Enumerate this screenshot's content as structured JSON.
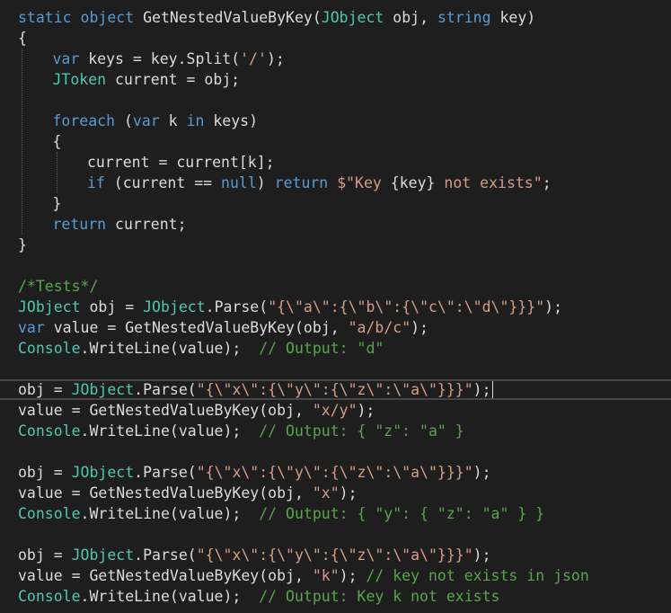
{
  "editor": {
    "theme": {
      "background": "#1e1e1e",
      "keyword": "#569cd6",
      "type": "#4ec9b0",
      "string": "#d69d85",
      "comment": "#57a64a",
      "text": "#dcdcdc"
    },
    "lines": [
      {
        "indent": 0,
        "tokens": [
          [
            "kw",
            "static"
          ],
          [
            "pl",
            " "
          ],
          [
            "kw",
            "object"
          ],
          [
            "pl",
            " GetNestedValueByKey("
          ],
          [
            "ty",
            "JObject"
          ],
          [
            "pl",
            " obj, "
          ],
          [
            "kw",
            "string"
          ],
          [
            "pl",
            " key)"
          ]
        ]
      },
      {
        "indent": 0,
        "tokens": [
          [
            "pl",
            "{"
          ]
        ]
      },
      {
        "indent": 1,
        "tokens": [
          [
            "kw",
            "var"
          ],
          [
            "pl",
            " keys = key.Split("
          ],
          [
            "st",
            "'/'"
          ],
          [
            "pl",
            ");"
          ]
        ]
      },
      {
        "indent": 1,
        "tokens": [
          [
            "ty",
            "JToken"
          ],
          [
            "pl",
            " current = obj;"
          ]
        ]
      },
      {
        "indent": 0,
        "tokens": []
      },
      {
        "indent": 1,
        "tokens": [
          [
            "kw",
            "foreach"
          ],
          [
            "pl",
            " ("
          ],
          [
            "kw",
            "var"
          ],
          [
            "pl",
            " k "
          ],
          [
            "kw",
            "in"
          ],
          [
            "pl",
            " keys)"
          ]
        ]
      },
      {
        "indent": 1,
        "tokens": [
          [
            "pl",
            "{"
          ]
        ]
      },
      {
        "indent": 2,
        "tokens": [
          [
            "pl",
            "current = current[k];"
          ]
        ]
      },
      {
        "indent": 2,
        "tokens": [
          [
            "kw",
            "if"
          ],
          [
            "pl",
            " (current == "
          ],
          [
            "kw",
            "null"
          ],
          [
            "pl",
            ") "
          ],
          [
            "kw",
            "return"
          ],
          [
            "pl",
            " "
          ],
          [
            "st",
            "$\"Key "
          ],
          [
            "pl",
            "{key}"
          ],
          [
            "st",
            " not exists\""
          ],
          [
            "pl",
            ";"
          ]
        ]
      },
      {
        "indent": 1,
        "tokens": [
          [
            "pl",
            "}"
          ]
        ]
      },
      {
        "indent": 1,
        "tokens": [
          [
            "kw",
            "return"
          ],
          [
            "pl",
            " current;"
          ]
        ]
      },
      {
        "indent": 0,
        "tokens": [
          [
            "pl",
            "}"
          ]
        ]
      },
      {
        "indent": 0,
        "tokens": []
      },
      {
        "indent": 0,
        "tokens": [
          [
            "cm",
            "/*Tests*/"
          ]
        ]
      },
      {
        "indent": 0,
        "tokens": [
          [
            "ty",
            "JObject"
          ],
          [
            "pl",
            " obj = "
          ],
          [
            "ty",
            "JObject"
          ],
          [
            "pl",
            ".Parse("
          ],
          [
            "st",
            "\"{\\\"a\\\":{\\\"b\\\":{\\\"c\\\":\\\"d\\\"}}}\""
          ],
          [
            "pl",
            ");"
          ]
        ]
      },
      {
        "indent": 0,
        "tokens": [
          [
            "kw",
            "var"
          ],
          [
            "pl",
            " value = GetNestedValueByKey(obj, "
          ],
          [
            "st",
            "\"a/b/c\""
          ],
          [
            "pl",
            ");"
          ]
        ]
      },
      {
        "indent": 0,
        "tokens": [
          [
            "ty",
            "Console"
          ],
          [
            "pl",
            ".WriteLine(value);  "
          ],
          [
            "cm",
            "// Output: \"d\""
          ]
        ]
      },
      {
        "indent": 0,
        "tokens": []
      },
      {
        "indent": 0,
        "current": true,
        "tokens": [
          [
            "pl",
            "obj = "
          ],
          [
            "ty",
            "JObject"
          ],
          [
            "pl",
            ".Parse("
          ],
          [
            "st",
            "\"{\\\"x\\\":{\\\"y\\\":{\\\"z\\\":\\\"a\\\"}}}\""
          ],
          [
            "pl",
            ");"
          ]
        ]
      },
      {
        "indent": 0,
        "tokens": [
          [
            "pl",
            "value = GetNestedValueByKey(obj, "
          ],
          [
            "st",
            "\"x/y\""
          ],
          [
            "pl",
            ");"
          ]
        ]
      },
      {
        "indent": 0,
        "tokens": [
          [
            "ty",
            "Console"
          ],
          [
            "pl",
            ".WriteLine(value);  "
          ],
          [
            "cm",
            "// Output: { \"z\": \"a\" }"
          ]
        ]
      },
      {
        "indent": 0,
        "tokens": []
      },
      {
        "indent": 0,
        "tokens": [
          [
            "pl",
            "obj = "
          ],
          [
            "ty",
            "JObject"
          ],
          [
            "pl",
            ".Parse("
          ],
          [
            "st",
            "\"{\\\"x\\\":{\\\"y\\\":{\\\"z\\\":\\\"a\\\"}}}\""
          ],
          [
            "pl",
            ");"
          ]
        ]
      },
      {
        "indent": 0,
        "tokens": [
          [
            "pl",
            "value = GetNestedValueByKey(obj, "
          ],
          [
            "st",
            "\"x\""
          ],
          [
            "pl",
            ");"
          ]
        ]
      },
      {
        "indent": 0,
        "tokens": [
          [
            "ty",
            "Console"
          ],
          [
            "pl",
            ".WriteLine(value);  "
          ],
          [
            "cm",
            "// Output: { \"y\": { \"z\": \"a\" } }"
          ]
        ]
      },
      {
        "indent": 0,
        "tokens": []
      },
      {
        "indent": 0,
        "tokens": [
          [
            "pl",
            "obj = "
          ],
          [
            "ty",
            "JObject"
          ],
          [
            "pl",
            ".Parse("
          ],
          [
            "st",
            "\"{\\\"x\\\":{\\\"y\\\":{\\\"z\\\":\\\"a\\\"}}}\""
          ],
          [
            "pl",
            ");"
          ]
        ]
      },
      {
        "indent": 0,
        "tokens": [
          [
            "pl",
            "value = GetNestedValueByKey(obj, "
          ],
          [
            "st",
            "\"k\""
          ],
          [
            "pl",
            "); "
          ],
          [
            "cm",
            "// key not exists in json"
          ]
        ]
      },
      {
        "indent": 0,
        "tokens": [
          [
            "ty",
            "Console"
          ],
          [
            "pl",
            ".WriteLine(value);  "
          ],
          [
            "cm",
            "// Output: Key k not exists"
          ]
        ]
      }
    ]
  }
}
